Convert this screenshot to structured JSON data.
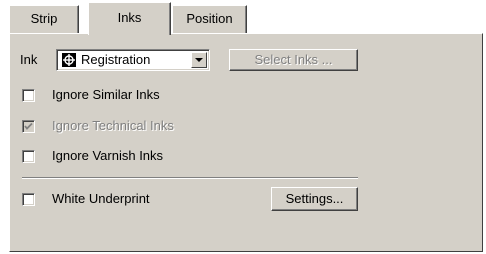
{
  "tabs": [
    {
      "label": "Strip",
      "active": false
    },
    {
      "label": "Inks",
      "active": true
    },
    {
      "label": "Position",
      "active": false
    }
  ],
  "ink": {
    "label": "Ink",
    "selected": "Registration",
    "icon": "registration-mark-icon"
  },
  "select_inks_button": {
    "label": "Select Inks ...",
    "disabled": true
  },
  "checkboxes": [
    {
      "label": "Ignore Similar Inks",
      "checked": false,
      "disabled": false
    },
    {
      "label": "Ignore Technical Inks",
      "checked": true,
      "disabled": true
    },
    {
      "label": "Ignore Varnish Inks",
      "checked": false,
      "disabled": false
    }
  ],
  "white_underprint": {
    "label": "White Underprint",
    "checked": false
  },
  "settings_button": {
    "label": "Settings..."
  },
  "colors": {
    "face": "#d4d0c8",
    "shadow": "#808080",
    "highlight": "#ffffff",
    "disabled_text": "#808080"
  }
}
